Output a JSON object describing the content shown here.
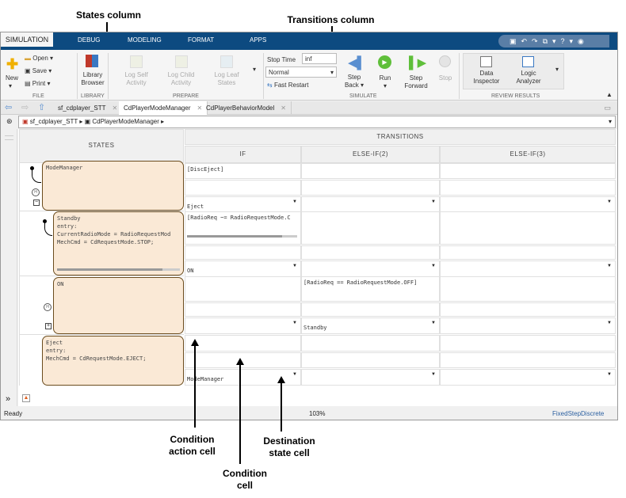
{
  "annotations": {
    "states_column": "States column",
    "transitions_column": "Transitions column",
    "condition_action_cell": "Condition action cell",
    "condition_cell": "Condition cell",
    "destination_state_cell": "Destination state cell"
  },
  "ribbon_tabs": [
    "SIMULATION",
    "DEBUG",
    "MODELING",
    "FORMAT",
    "APPS"
  ],
  "ribbon": {
    "file": {
      "new": "New",
      "open": "Open",
      "save": "Save",
      "print": "Print",
      "label": "FILE"
    },
    "library": {
      "browser": "Library Browser",
      "label": "LIBRARY"
    },
    "prepare": {
      "log_self": "Log Self Activity",
      "log_child": "Log Child Activity",
      "log_leaf": "Log Leaf States",
      "label": "PREPARE"
    },
    "stop_time_label": "Stop Time",
    "stop_time_value": "inf",
    "mode_value": "Normal",
    "fast_restart": "Fast Restart",
    "simulate": {
      "step_back": "Step Back",
      "run": "Run",
      "step_forward": "Step Forward",
      "stop": "Stop",
      "label": "SIMULATE"
    },
    "review": {
      "data_inspector": "Data Inspector",
      "logic_analyzer": "Logic Analyzer",
      "label": "REVIEW RESULTS"
    }
  },
  "doc_tabs": [
    "sf_cdplayer_STT",
    "CdPlayerModeManager",
    "CdPlayerBehaviorModel"
  ],
  "breadcrumb": [
    "sf_cdplayer_STT",
    "CdPlayerModeManager"
  ],
  "table": {
    "states_header": "STATES",
    "transitions_header": "TRANSITIONS",
    "columns": [
      "IF",
      "ELSE-IF(2)",
      "ELSE-IF(3)"
    ],
    "states": [
      "ModeManager",
      "Standby\nentry:\nCurrentRadioMode = RadioRequestMod\nMechCmd = CdRequestMode.STOP;",
      "ON",
      "Eject\nentry:\nMechCmd = CdRequestMode.EJECT;"
    ],
    "rows": [
      {
        "cond": [
          "[DiscEject]",
          "",
          ""
        ],
        "action": [
          "",
          "",
          ""
        ],
        "dest": [
          "Eject",
          "",
          ""
        ]
      },
      {
        "cond": [
          "[RadioReq ~= RadioRequestMode.C",
          "",
          ""
        ],
        "action": [
          "",
          "",
          ""
        ],
        "dest": [
          "ON",
          "",
          ""
        ]
      },
      {
        "cond": [
          "",
          "[RadioReq == RadioRequestMode.OFF]",
          ""
        ],
        "action": [
          "",
          "",
          ""
        ],
        "dest": [
          "",
          "Standby",
          ""
        ]
      },
      {
        "cond": [
          "",
          "",
          ""
        ],
        "action": [
          "",
          "",
          ""
        ],
        "dest": [
          "ModeManager",
          "",
          ""
        ]
      }
    ]
  },
  "status": {
    "left": "Ready",
    "zoom": "103%",
    "solver": "FixedStepDiscrete"
  }
}
